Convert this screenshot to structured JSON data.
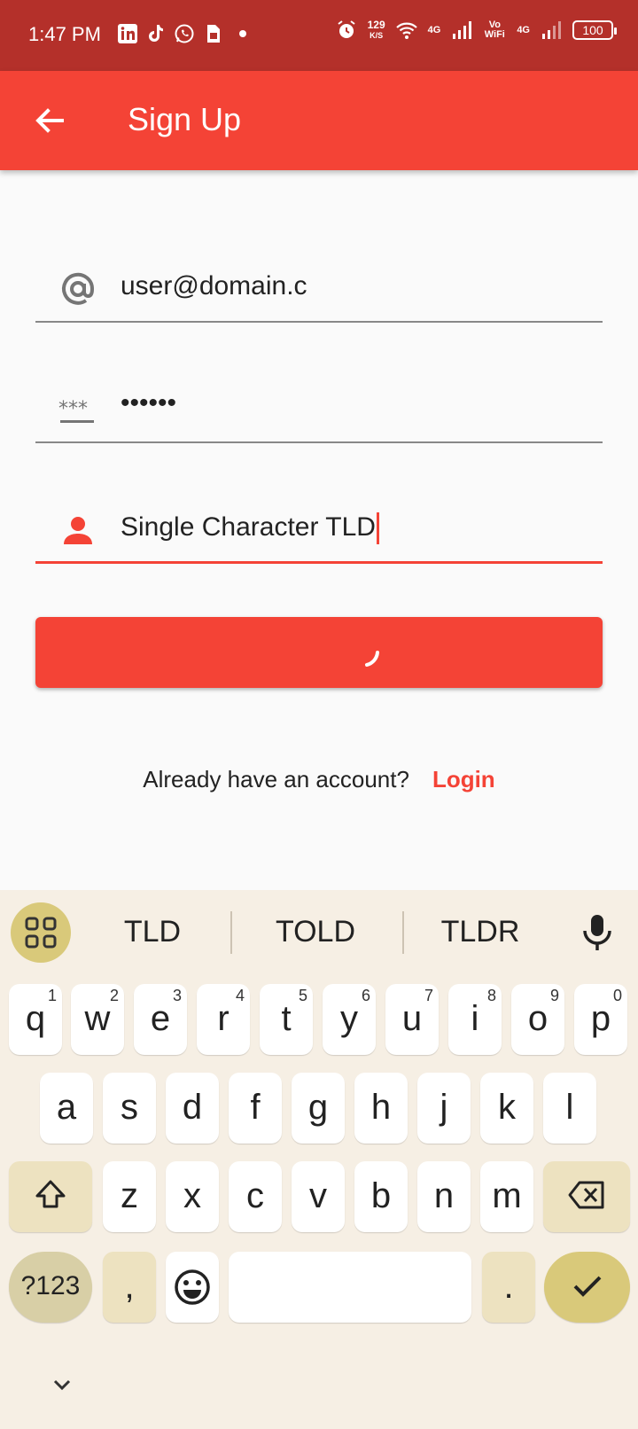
{
  "status_bar": {
    "time": "1:47 PM",
    "net_speed_value": "129",
    "net_speed_unit": "K/S",
    "signal1_label": "4G",
    "volte_label": "Vo WiFi",
    "signal2_label": "4G",
    "battery": "100"
  },
  "app_bar": {
    "title": "Sign Up"
  },
  "form": {
    "email_value": "user@domain.c",
    "password_value": "••••••",
    "name_value": "Single Character TLD"
  },
  "login_prompt": {
    "text": "Already have an account?",
    "link": "Login"
  },
  "keyboard": {
    "suggestions": [
      "TLD",
      "TOLD",
      "TLDR"
    ],
    "row1": [
      {
        "k": "q",
        "n": "1"
      },
      {
        "k": "w",
        "n": "2"
      },
      {
        "k": "e",
        "n": "3"
      },
      {
        "k": "r",
        "n": "4"
      },
      {
        "k": "t",
        "n": "5"
      },
      {
        "k": "y",
        "n": "6"
      },
      {
        "k": "u",
        "n": "7"
      },
      {
        "k": "i",
        "n": "8"
      },
      {
        "k": "o",
        "n": "9"
      },
      {
        "k": "p",
        "n": "0"
      }
    ],
    "row2": [
      "a",
      "s",
      "d",
      "f",
      "g",
      "h",
      "j",
      "k",
      "l"
    ],
    "row3": [
      "z",
      "x",
      "c",
      "v",
      "b",
      "n",
      "m"
    ],
    "symbols_label": "?123",
    "comma_label": ",",
    "period_label": ".",
    "colors": {
      "accent": "#d9c97a",
      "function_key": "#ede2c0",
      "background": "#f6efe4"
    }
  },
  "colors": {
    "primary": "#f44336",
    "status_bar": "#b4302a"
  }
}
